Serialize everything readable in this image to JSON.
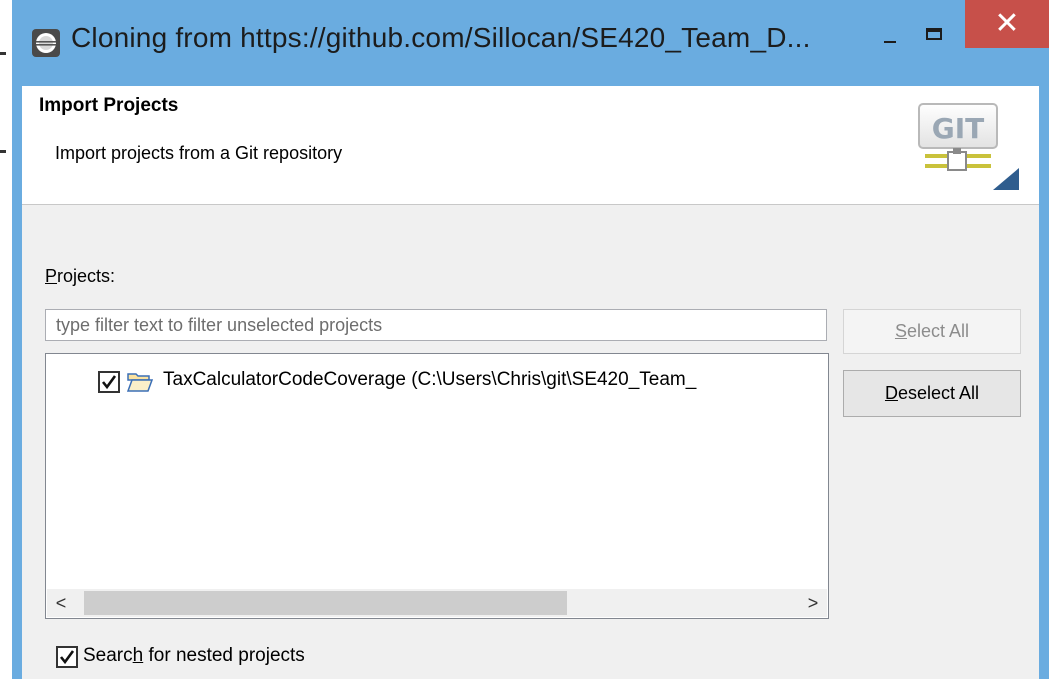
{
  "window": {
    "title": "Cloning from https://github.com/Sillocan/SE420_Team_D...",
    "minimize_label": "−",
    "close_label": "✕"
  },
  "header": {
    "title": "Import Projects",
    "subtitle": "Import projects from a Git repository",
    "logo_text": "GIT"
  },
  "projects": {
    "label_mnemonic": "P",
    "label_rest": "rojects:",
    "filter_placeholder": "type filter text to filter unselected projects",
    "filter_value": "",
    "items": [
      {
        "label": "TaxCalculatorCodeCoverage (C:\\Users\\Chris\\git\\SE420_Team_",
        "checked": true,
        "icon": "folder-icon"
      }
    ],
    "scroll_left": "<",
    "scroll_right": ">"
  },
  "buttons": {
    "select_all_mnemonic": "S",
    "select_all_rest": "elect All",
    "deselect_all_mnemonic": "D",
    "deselect_all_rest": "eselect All"
  },
  "options": {
    "nested_label_pre": "Searc",
    "nested_label_mnemonic": "h",
    "nested_label_post": " for nested projects",
    "nested_checked": true
  },
  "colors": {
    "titlebar": "#6aace0",
    "close_button": "#c7504a",
    "dialog_bg": "#f0f0f0"
  }
}
